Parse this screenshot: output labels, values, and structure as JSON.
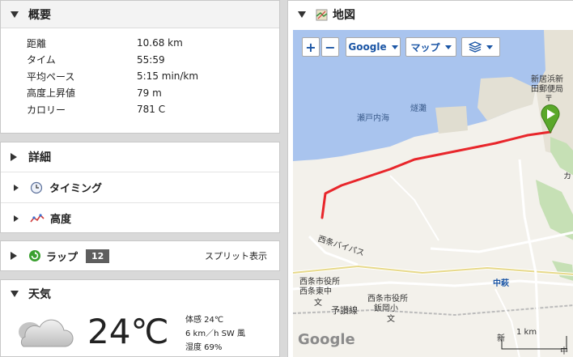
{
  "summary": {
    "title": "概要",
    "rows": [
      {
        "label": "距離",
        "value": "10.68 km"
      },
      {
        "label": "タイム",
        "value": "55:59"
      },
      {
        "label": "平均ペース",
        "value": "5:15 min/km"
      },
      {
        "label": "高度上昇値",
        "value": "79 m"
      },
      {
        "label": "カロリー",
        "value": "781 C"
      }
    ]
  },
  "details": {
    "title": "詳細",
    "timing_label": "タイミング",
    "elevation_label": "高度"
  },
  "laps": {
    "title": "ラップ",
    "count": "12",
    "split_link": "スプリット表示"
  },
  "weather": {
    "title": "天気",
    "temperature": "24℃",
    "feels_like": "体感 24℃",
    "wind": "6 km／h SW 風",
    "humidity": "湿度 69%"
  },
  "map": {
    "title": "地図",
    "zoom_in": "+",
    "zoom_out": "−",
    "provider": "Google",
    "map_type": "マップ",
    "labels": {
      "new_station": "新居浜新",
      "post_office": "田郵便局",
      "T_mark": "〒",
      "seto": "瀬戸内海",
      "nada": "燧灘",
      "saijo_bypass": "西条バイパス",
      "saijo_city1": "西条市役所",
      "saijo_east": "西条東中",
      "saijo_city2": "西条市役所",
      "iioka": "飯岡小",
      "yosan": "予讃線",
      "nakahagi": "中萩",
      "bun1": "文",
      "bun2": "文",
      "kan": "カ",
      "shinbyoin": "新",
      "koban": "中",
      "scale_km": "1 km",
      "google_logo": "Google"
    }
  },
  "colors": {
    "route": "#e8262b",
    "accent_blue": "#1a55a5",
    "sea": "#a9c4ee",
    "land": "#f3f1eb",
    "pin": "#5aa82a"
  }
}
